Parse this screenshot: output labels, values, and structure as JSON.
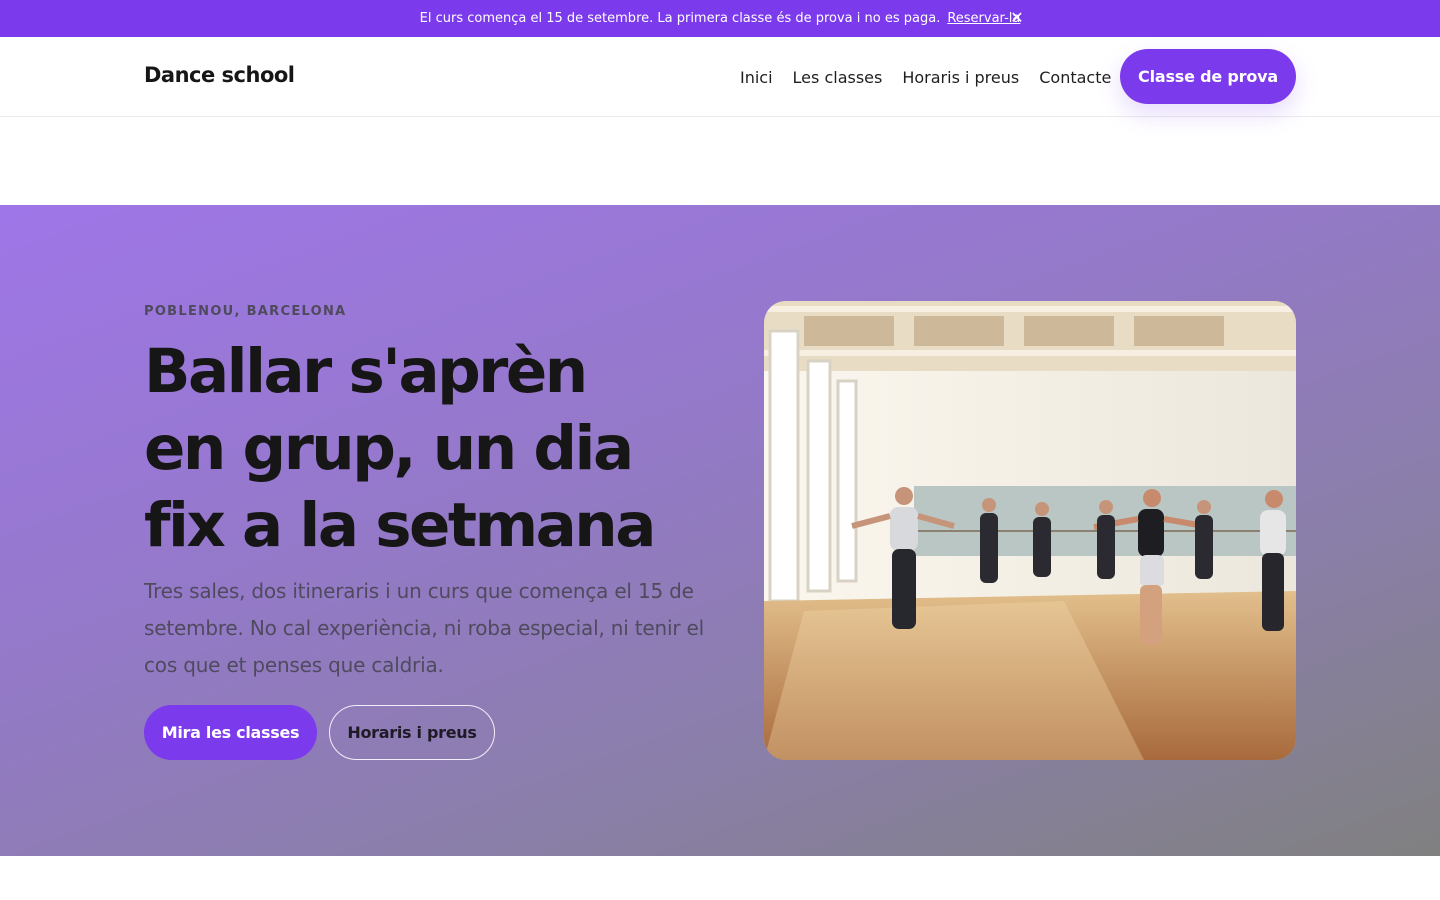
{
  "announcement": {
    "message": "El curs comença el 15 de setembre. La primera classe és de prova i no es paga.",
    "link": "Reservar-la",
    "close": "✕"
  },
  "nav": {
    "brand": "Dance school",
    "links": [
      "Inici",
      "Les classes",
      "Horaris i preus",
      "Contacte"
    ],
    "cta": "Classe de prova"
  },
  "hero": {
    "eyebrow": "POBLENOU, BARCELONA",
    "headline": [
      "Ballar s'aprèn",
      "en grup, un dia",
      "fix a la setmana"
    ],
    "subtitle": "Tres sales, dos itineraris i un curs que comença el 15 de setembre. No cal experiència, ni roba especial, ni tenir el cos que et penses que caldria.",
    "primary_button": "Mira les classes",
    "secondary_button": "Horaris i preus"
  },
  "colors": {
    "accent": "#7c3aed",
    "hero_gradient_start": "#9f76e8",
    "hero_gradient_end": "#808080",
    "heading": "#161616"
  }
}
